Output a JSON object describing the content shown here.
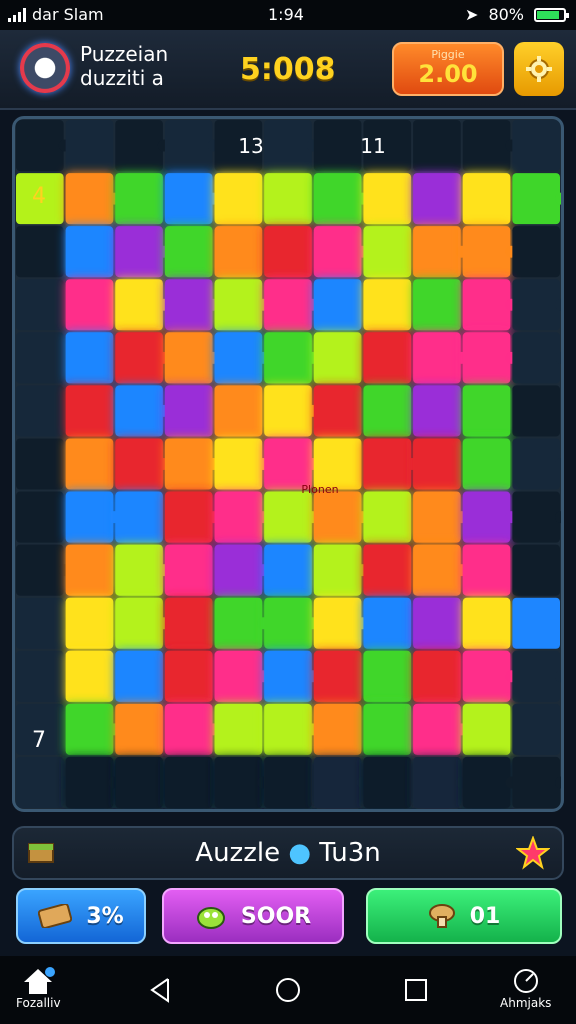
{
  "status_bar": {
    "carrier": "dar Slam",
    "time": "1:94",
    "battery": "80%"
  },
  "header": {
    "app_title_line1": "Puzzeian",
    "app_title_line2": "duzziti a",
    "timer": "5:008",
    "score_label": "Piggie",
    "score_value": "2.00",
    "settings_icon": "gear-icon"
  },
  "board": {
    "rows": 13,
    "cols": 11,
    "top_labels": [
      "13",
      "11"
    ],
    "side_labels": [
      "4",
      "7"
    ],
    "center_label": "Plonen",
    "palette": {
      "red": "#e8262e",
      "green": "#3fd62a",
      "yellow": "#ffe21a",
      "orange": "#ff8a1a",
      "blue": "#1e86ff",
      "magenta": "#ff2d8a",
      "purple": "#9a2ed8",
      "lime": "#b4f21a",
      "dark": "#16283a",
      "darker": "#0f1d2a"
    }
  },
  "banner": {
    "text_part1": "Auzzle",
    "dot": "●",
    "text_part2": "Tu3n"
  },
  "actions": {
    "left_label": "3%",
    "middle_label": "SOOR",
    "right_label": "01"
  },
  "nav": {
    "home_label": "Fozalliv",
    "right_label": "Ahmjaks"
  }
}
